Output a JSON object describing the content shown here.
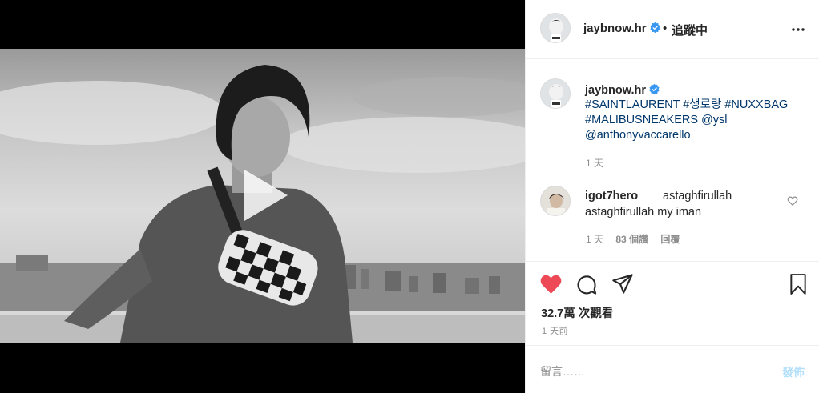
{
  "post": {
    "author": "jaybnow.hr",
    "separator": "•",
    "follow_status": "追蹤中",
    "caption": {
      "author": "jaybnow.hr",
      "tags": [
        "#SAINTLAURENT",
        "#생로랑",
        "#NUXXBAG",
        "#MALIBUSNEAKERS",
        "@ysl",
        "@anthonyvaccarello"
      ],
      "time": "1 天"
    },
    "comments": [
      {
        "author": "igot7hero",
        "text_line1": "astaghfirullah",
        "text_line2": "astaghfirullah my iman",
        "time": "1 天",
        "likes": "83 個讚",
        "reply_label": "回覆"
      }
    ],
    "views": "32.7萬 次觀看",
    "posted_ago": "1 天前",
    "comment_placeholder": "留言……",
    "post_button": "發佈"
  },
  "colors": {
    "like_red": "#ed4956",
    "verified_blue": "#3897f0",
    "hashtag_blue": "#00376b",
    "muted": "#8e8e8e",
    "post_button_disabled": "#b2dffc"
  },
  "icons": {
    "play": "play-icon",
    "more": "more-options-icon",
    "like": "heart-icon",
    "comment": "comment-icon",
    "share": "share-icon",
    "save": "bookmark-icon",
    "verified": "verified-badge-icon"
  }
}
